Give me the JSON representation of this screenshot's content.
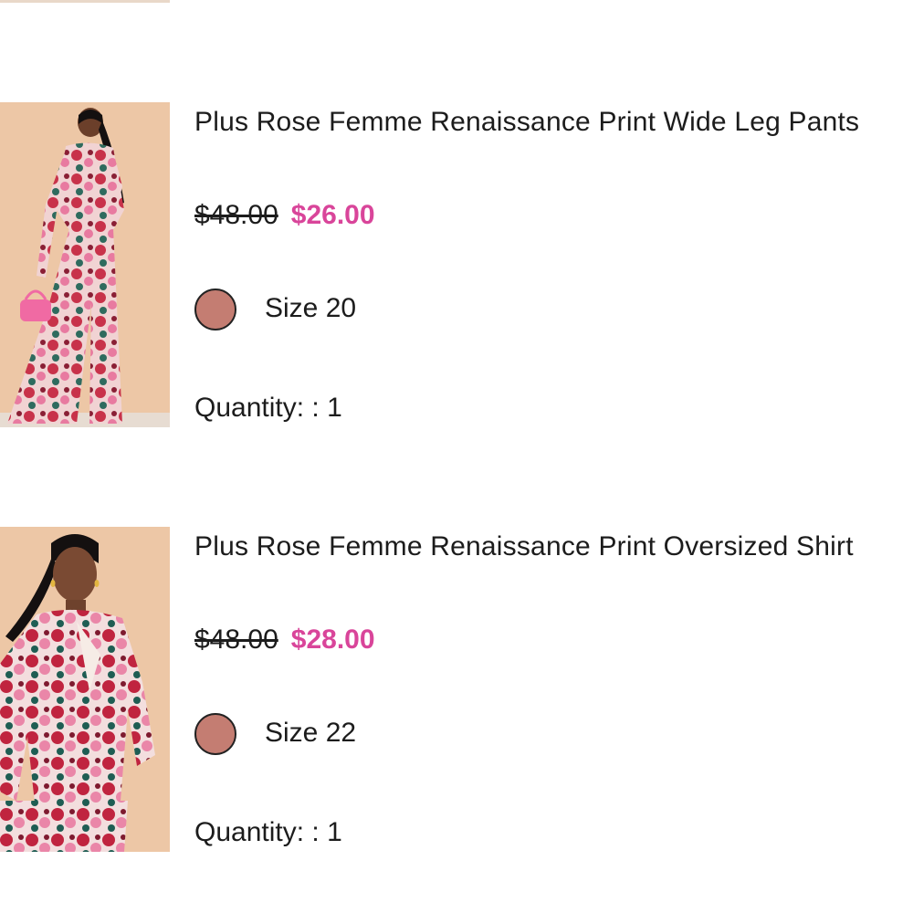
{
  "cart": {
    "items": [
      {
        "title": "Plus Rose Femme Renaissance Print Wide Leg Pants",
        "original_price": "$48.00",
        "sale_price": "$26.00",
        "size_label": "Size 20",
        "quantity_label": "Quantity: : 1",
        "swatch_color": "#c47d72"
      },
      {
        "title": "Plus Rose Femme Renaissance Print Oversized Shirt",
        "original_price": "$48.00",
        "sale_price": "$28.00",
        "size_label": "Size 22",
        "quantity_label": "Quantity: : 1",
        "swatch_color": "#c47d72"
      }
    ]
  },
  "colors": {
    "sale_price": "#d9459a",
    "image_background": "#edc7a6"
  }
}
